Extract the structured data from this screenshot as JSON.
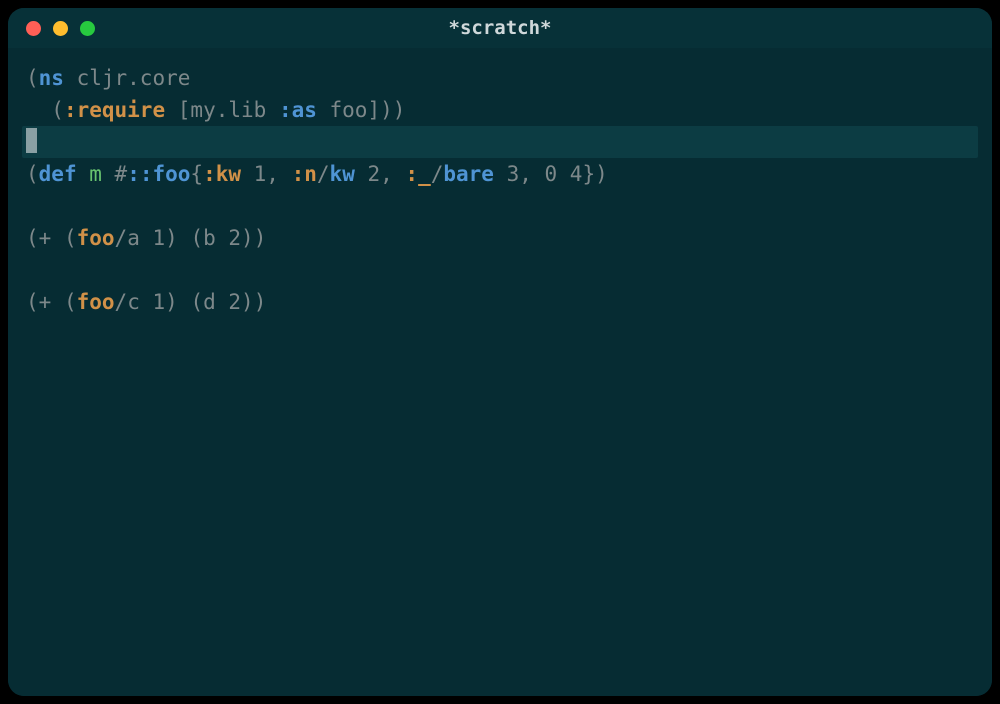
{
  "window": {
    "title": "*scratch*",
    "traffic_lights": [
      "close",
      "minimize",
      "zoom"
    ]
  },
  "editor": {
    "language": "clojure",
    "cursor_line_index": 2,
    "lines_plain": [
      "(ns cljr.core",
      "  (:require [my.lib :as foo]))",
      "",
      "(def m #::foo{:kw 1, :n/kw 2, :_/bare 3, 0 4})",
      "",
      "(+ (foo/a 1) (b 2))",
      "",
      "(+ (foo/c 1) (d 2))"
    ],
    "lines": [
      [
        {
          "t": "(",
          "c": "paren"
        },
        {
          "t": "ns",
          "c": "kw-blue"
        },
        {
          "t": " cljr.core",
          "c": ""
        }
      ],
      [
        {
          "t": "  ",
          "c": ""
        },
        {
          "t": "(",
          "c": "paren"
        },
        {
          "t": ":require",
          "c": "kw-orange"
        },
        {
          "t": " ",
          "c": ""
        },
        {
          "t": "[",
          "c": "paren"
        },
        {
          "t": "my.lib ",
          "c": ""
        },
        {
          "t": ":as",
          "c": "kw-blue"
        },
        {
          "t": " foo",
          "c": ""
        },
        {
          "t": "]",
          "c": "paren"
        },
        {
          "t": ")",
          "c": "paren"
        },
        {
          "t": ")",
          "c": "paren"
        }
      ],
      [],
      [
        {
          "t": "(",
          "c": "paren"
        },
        {
          "t": "def",
          "c": "kw-blue"
        },
        {
          "t": " ",
          "c": ""
        },
        {
          "t": "m",
          "c": "sym-green"
        },
        {
          "t": " #",
          "c": ""
        },
        {
          "t": "::foo",
          "c": "kw-blue"
        },
        {
          "t": "{",
          "c": "paren"
        },
        {
          "t": ":kw",
          "c": "kw-orange"
        },
        {
          "t": " 1, ",
          "c": ""
        },
        {
          "t": ":n",
          "c": "kw-orange"
        },
        {
          "t": "/",
          "c": ""
        },
        {
          "t": "kw",
          "c": "kw-blue"
        },
        {
          "t": " 2, ",
          "c": ""
        },
        {
          "t": ":_",
          "c": "kw-orange"
        },
        {
          "t": "/",
          "c": ""
        },
        {
          "t": "bare",
          "c": "kw-blue"
        },
        {
          "t": " 3, 0 4",
          "c": ""
        },
        {
          "t": "}",
          "c": "paren"
        },
        {
          "t": ")",
          "c": "paren"
        }
      ],
      [],
      [
        {
          "t": "(",
          "c": "paren"
        },
        {
          "t": "+ ",
          "c": ""
        },
        {
          "t": "(",
          "c": "paren"
        },
        {
          "t": "foo",
          "c": "kw-orange"
        },
        {
          "t": "/a 1",
          "c": ""
        },
        {
          "t": ")",
          "c": "paren"
        },
        {
          "t": " ",
          "c": ""
        },
        {
          "t": "(",
          "c": "paren"
        },
        {
          "t": "b 2",
          "c": ""
        },
        {
          "t": ")",
          "c": "paren"
        },
        {
          "t": ")",
          "c": "paren"
        }
      ],
      [],
      [
        {
          "t": "(",
          "c": "paren"
        },
        {
          "t": "+ ",
          "c": ""
        },
        {
          "t": "(",
          "c": "paren"
        },
        {
          "t": "foo",
          "c": "kw-orange"
        },
        {
          "t": "/c 1",
          "c": ""
        },
        {
          "t": ")",
          "c": "paren"
        },
        {
          "t": " ",
          "c": ""
        },
        {
          "t": "(",
          "c": "paren"
        },
        {
          "t": "d 2",
          "c": ""
        },
        {
          "t": ")",
          "c": "paren"
        },
        {
          "t": ")",
          "c": "paren"
        }
      ]
    ]
  }
}
